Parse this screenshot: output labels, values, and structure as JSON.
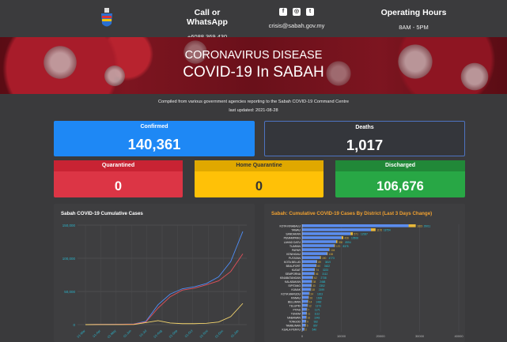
{
  "header": {
    "contact": {
      "title": "Call or WhatsApp",
      "phone": "+6088 369 430"
    },
    "social": {
      "icons": [
        "facebook-icon",
        "instagram-icon",
        "twitter-icon"
      ],
      "email": "crisis@sabah.gov.my",
      "labels": [
        "f",
        "◎",
        "t"
      ]
    },
    "hours": {
      "title": "Operating Hours",
      "value": "8AM - 5PM"
    }
  },
  "banner": {
    "line1": "CORONAVIRUS DISEASE",
    "line2": "COVID-19 In SABAH"
  },
  "info": {
    "compiled": "Compiled from various government agencies reporting to the Sabah COVID-19 Command Centre",
    "updated": "last updated: 2021-08-28"
  },
  "stats": {
    "confirmed": {
      "label": "Confirmed",
      "value": "140,361"
    },
    "deaths": {
      "label": "Deaths",
      "value": "1,017"
    },
    "quarantined": {
      "label": "Quarantined",
      "value": "0"
    },
    "home_quarantine": {
      "label": "Home Quarantine",
      "value": "0"
    },
    "discharged": {
      "label": "Discharged",
      "value": "106,676"
    }
  },
  "colors": {
    "confirmed": "#1e88f5",
    "quarantined": "#dc3545",
    "home_quarantine": "#ffc107",
    "discharged": "#28a745",
    "deaths_border": "#4e73c0"
  },
  "chart_data": [
    {
      "type": "line",
      "title": "Sabah COVID-19 Cumulative Cases",
      "ylim": [
        0,
        150000
      ],
      "yticks": [
        "150,000",
        "100,000",
        "50,000",
        "0"
      ],
      "xticks": [
        "01-Mar",
        "01-Apr",
        "01-May",
        "01-Jun",
        "01-Jul",
        "01-Aug",
        "01-Sep",
        "01-Oct",
        "01-Nov",
        "01-Dec",
        "01-Jan"
      ],
      "series": [
        {
          "name": "",
          "color": "#4e8ef7",
          "values": [
            0,
            400,
            500,
            600,
            1000,
            5000,
            30000,
            46000,
            54000,
            57000,
            62000,
            72000,
            95000,
            140361
          ]
        },
        {
          "name": "",
          "color": "#e0505a",
          "values": [
            0,
            300,
            400,
            500,
            800,
            4000,
            25000,
            42000,
            52000,
            55000,
            60000,
            66000,
            80000,
            106676
          ]
        },
        {
          "name": "",
          "color": "#f5d66e",
          "values": [
            0,
            100,
            100,
            100,
            200,
            3000,
            6000,
            2500,
            1500,
            1500,
            2000,
            4000,
            12000,
            32000
          ]
        }
      ],
      "grid": true
    },
    {
      "type": "bar",
      "title": "Sabah: Cumulative COVID-19 Cases By District (Last 3 Days Change)",
      "xlim": [
        0,
        40000
      ],
      "xticks": [
        "0",
        "10000",
        "20000",
        "30000",
        "40000"
      ],
      "categories": [
        "KOTA KINABALU",
        "TAWAU",
        "SANDAKAN",
        "PENAMPANG",
        "LAHAD DATU",
        "TUARAN",
        "PAPAR",
        "KENINGAU",
        "PUTATAN",
        "KOTA BELUD",
        "BEAUFORT",
        "KUDAT",
        "SEMPORNA",
        "KINABATANGAN",
        "KALABAKAN",
        "SIPITANG",
        "KUNAK",
        "KOTA MARUDU",
        "RANAU",
        "BELURAN",
        "TELUPID",
        "PITAS",
        "TENOM",
        "NABAWAN",
        "TONGOD",
        "TAMBUNAN",
        "KUALA PENYU"
      ],
      "values": [
        29011,
        18754,
        12937,
        10508,
        8994,
        8375,
        7000,
        6500,
        4773,
        3819,
        3622,
        3223,
        3112,
        2738,
        2468,
        2352,
        2199,
        1813,
        1626,
        1482,
        1373,
        1171,
        1112,
        1043,
        932,
        857,
        540
      ],
      "changes": [
        "1823",
        "1176",
        "571",
        "428",
        "300",
        "170",
        "104",
        "138",
        "190",
        "89",
        "60",
        "74",
        "46",
        "62",
        "38",
        "33",
        "18",
        "24",
        "26",
        "14",
        "12",
        "7",
        "11",
        "16",
        "9",
        "5",
        "2"
      ],
      "value_labels": [
        "29011",
        "18754",
        "12937",
        "10508",
        "8994",
        "8375",
        "",
        "",
        "4773",
        "3819",
        "3622",
        "3223",
        "3112",
        "2738",
        "2468",
        "2352",
        "2199",
        "1813",
        "1626",
        "1482",
        "1373",
        "1171",
        "1112",
        "1043",
        "932",
        "857",
        "540"
      ],
      "colors": {
        "bar": "#5b8dee",
        "change": "#e8b83a",
        "label": "#25c6da"
      }
    }
  ]
}
